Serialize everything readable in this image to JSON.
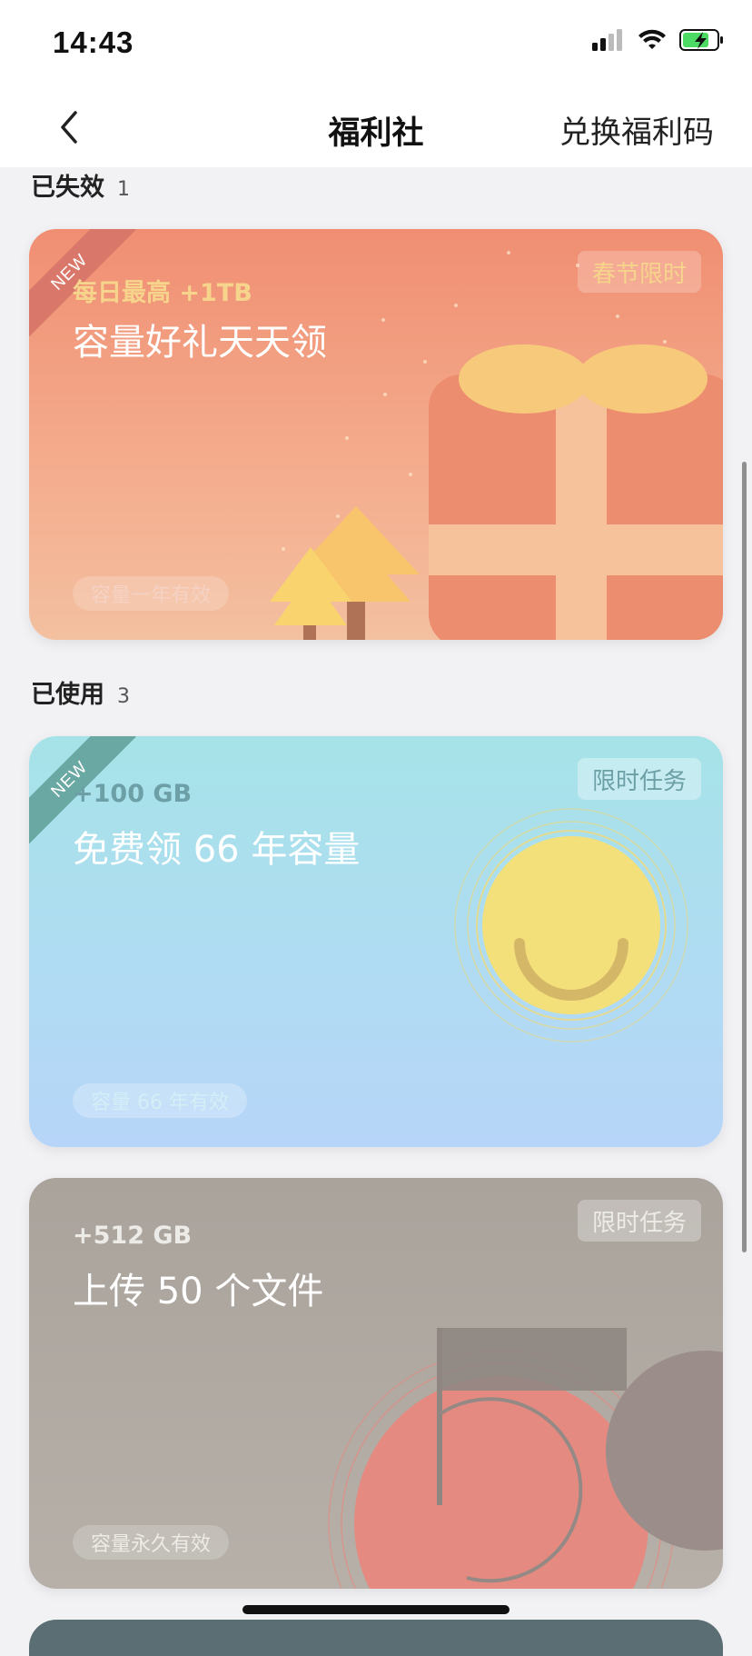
{
  "status_bar": {
    "time": "14:43",
    "battery_color": "#4cd964"
  },
  "nav": {
    "back_icon": "chevron-left-icon",
    "title": "福利社",
    "action": "兑换福利码"
  },
  "sections": [
    {
      "label": "已失效",
      "count": "1"
    },
    {
      "label": "已使用",
      "count": "3"
    }
  ],
  "cards": [
    {
      "ribbon": "NEW",
      "badge": "春节限时",
      "amount": "每日最高 +1TB",
      "title": "容量好礼天天领",
      "validity": "容量一年有效",
      "colors": {
        "amount": "#f7d48c",
        "validity": "#f5d2c3"
      }
    },
    {
      "ribbon": "NEW",
      "badge": "限时任务",
      "amount": "+100 GB",
      "title": "免费领 66 年容量",
      "validity": "容量 66 年有效",
      "colors": {
        "amount": "#6c9fa6",
        "validity": "#d4eef7"
      }
    },
    {
      "badge": "限时任务",
      "amount": "+512 GB",
      "title": "上传 50 个文件",
      "validity": "容量永久有效",
      "colors": {
        "amount": "#ecebe7",
        "validity": "#eeebe6"
      }
    }
  ]
}
